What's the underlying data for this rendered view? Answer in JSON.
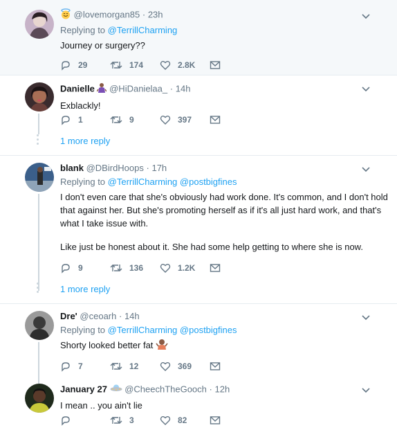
{
  "tweets": [
    {
      "display_name": "",
      "handle": "@lovemorgan85",
      "time": "23h",
      "replying_label": "Replying to",
      "replying_to": [
        "@TerrillCharming"
      ],
      "text": "Journey or surgery??",
      "replies": "29",
      "retweets": "174",
      "likes": "2.8K"
    },
    {
      "display_name": "Danielle",
      "handle": "@HiDanielaa_",
      "time": "14h",
      "text": "Exblackly!",
      "replies": "1",
      "retweets": "9",
      "likes": "397",
      "more_replies": "1 more reply"
    },
    {
      "display_name": "blank",
      "handle": "@DBirdHoops",
      "time": "17h",
      "replying_label": "Replying to",
      "replying_to": [
        "@TerrillCharming",
        "@postbigfines"
      ],
      "text": "I don't even care that she's obviously had work done. It's common, and I don't hold that against her. But she's promoting herself as if it's all just hard work, and that's what I take issue with.",
      "text2": "Like just be honest about it. She had some help getting to where she is now.",
      "replies": "9",
      "retweets": "136",
      "likes": "1.2K",
      "more_replies": "1 more reply"
    },
    {
      "display_name": "Dre'",
      "handle": "@ceoarh",
      "time": "14h",
      "replying_label": "Replying to",
      "replying_to": [
        "@TerrillCharming",
        "@postbigfines"
      ],
      "text": "Shorty looked better fat",
      "replies": "7",
      "retweets": "12",
      "likes": "369"
    },
    {
      "display_name": "January 27",
      "handle": "@CheechTheGooch",
      "time": "12h",
      "text": "I mean .. you ain't lie",
      "replies": "",
      "retweets": "3",
      "likes": "82"
    }
  ],
  "separator": "·",
  "icons": {
    "reply": "reply-icon",
    "retweet": "retweet-icon",
    "like": "heart-icon",
    "dm": "envelope-icon",
    "caret": "chevron-down-icon"
  },
  "colors": {
    "link": "#1da1f2",
    "muted": "#657786",
    "highlight_bg": "#f5f8fa",
    "thread_line": "#ccd6dd"
  }
}
